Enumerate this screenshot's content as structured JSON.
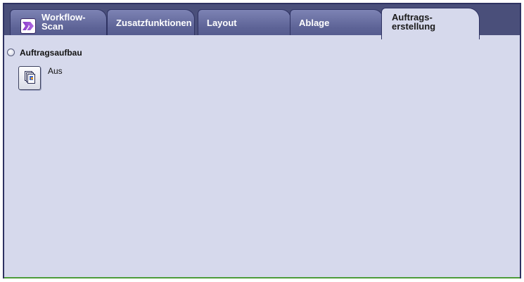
{
  "tabs": [
    {
      "id": "workflow",
      "label_line1": "Workflow-",
      "label_line2": "Scan",
      "icon": "workflow-scan-chevron-icon"
    },
    {
      "id": "zusatz",
      "label": "Zusatzfunktionen"
    },
    {
      "id": "layout",
      "label": "Layout"
    },
    {
      "id": "ablage",
      "label": "Ablage"
    },
    {
      "id": "auftrag",
      "label_line1": "Auftrags-",
      "label_line2": "erstellung",
      "active": true
    }
  ],
  "panel": {
    "feature": {
      "title": "Auftragsaufbau",
      "value": "Aus",
      "icon": "build-job-document-icon"
    }
  },
  "colors": {
    "tab_bar": "#4a4f7a",
    "tab_inactive": "#5d6396",
    "panel_bg": "#d6d9ec",
    "border": "#2e3262",
    "accent_green": "#4d9b3a"
  }
}
